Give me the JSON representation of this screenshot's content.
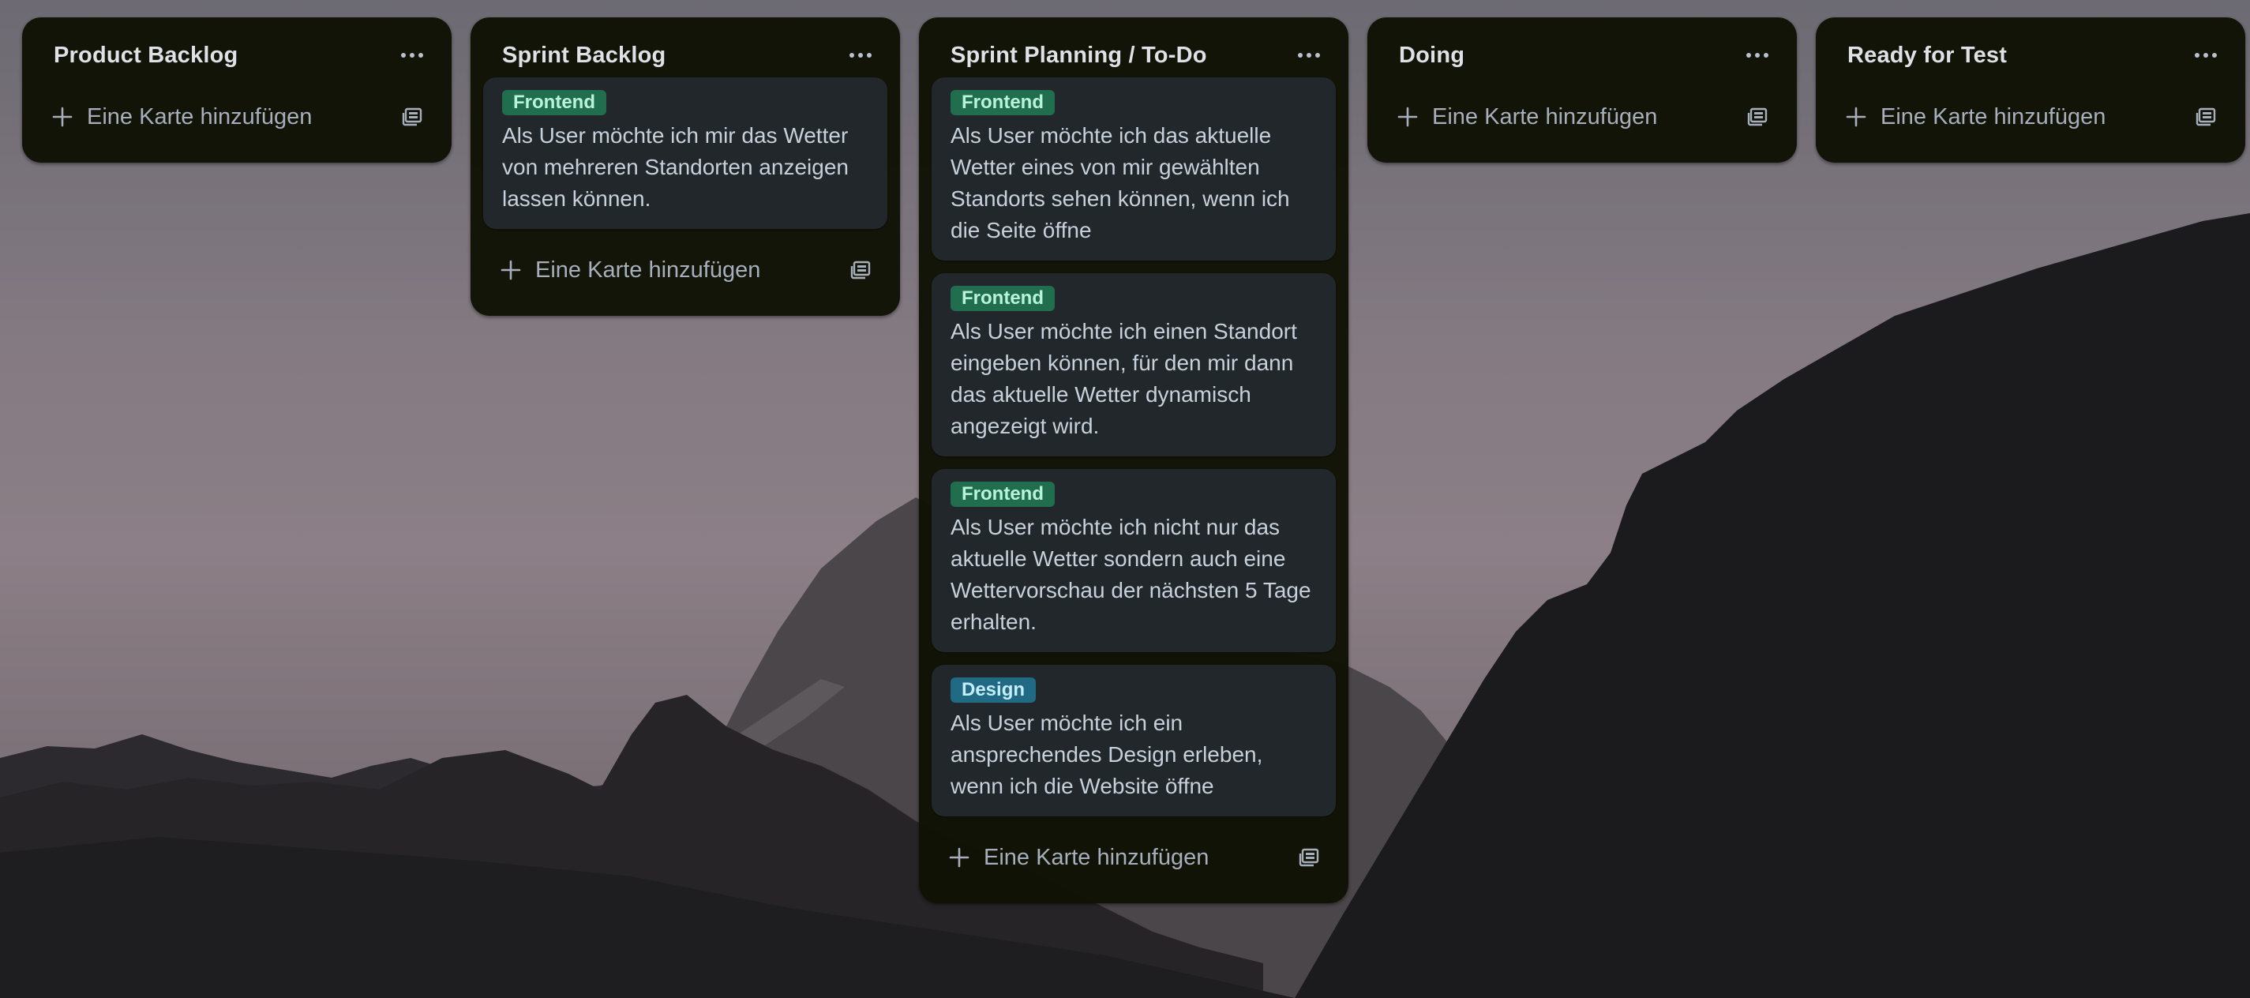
{
  "colors": {
    "list_bg": "#101204",
    "card_bg": "#22272b",
    "title_text": "#dfe1e6",
    "card_text": "#c7d1db",
    "muted_text": "#a6afbb",
    "label_frontend_bg": "#216e4e",
    "label_frontend_text": "#baf3db",
    "label_design_bg": "#206a83",
    "label_design_text": "#c6edfb"
  },
  "icons": {
    "menu": "ellipsis-icon",
    "add": "plus-icon",
    "template": "card-template-icon"
  },
  "lists": [
    {
      "title": "Product Backlog",
      "add_label": "Eine Karte hinzufügen",
      "cards": []
    },
    {
      "title": "Sprint Backlog",
      "add_label": "Eine Karte hinzufügen",
      "cards": [
        {
          "label": "Frontend",
          "text": "Als User möchte ich mir das Wetter von mehreren Standorten anzeigen lassen können."
        }
      ]
    },
    {
      "title": "Sprint Planning / To-Do",
      "add_label": "Eine Karte hinzufügen",
      "cards": [
        {
          "label": "Frontend",
          "text": "Als User möchte ich das aktuelle Wetter eines von mir gewählten Standorts sehen können, wenn ich die Seite öffne"
        },
        {
          "label": "Frontend",
          "text": "Als User möchte ich einen Standort eingeben können, für den mir dann das aktuelle Wetter dynamisch angezeigt wird."
        },
        {
          "label": "Frontend",
          "text": "Als User möchte ich nicht nur das aktuelle Wetter sondern auch eine Wettervorschau der nächsten 5 Tage erhalten."
        },
        {
          "label": "Design",
          "text": "Als User möchte ich ein ansprechendes Design erleben, wenn ich die Website öffne"
        }
      ]
    },
    {
      "title": "Doing",
      "add_label": "Eine Karte hinzufügen",
      "cards": []
    },
    {
      "title": "Ready for Test",
      "add_label": "Eine Karte hinzufügen",
      "cards": []
    }
  ]
}
